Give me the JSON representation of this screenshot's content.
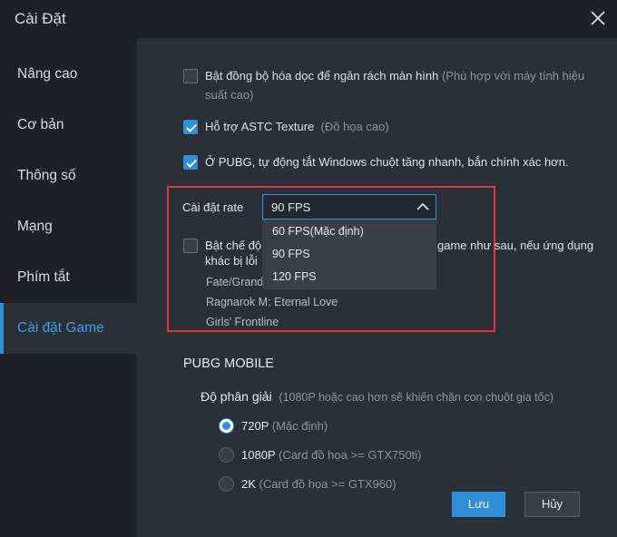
{
  "window": {
    "title": "Cài Đặt"
  },
  "sidebar": {
    "items": [
      {
        "label": "Nâng cao"
      },
      {
        "label": "Cơ bản"
      },
      {
        "label": "Thông số"
      },
      {
        "label": "Mạng"
      },
      {
        "label": "Phím tắt"
      },
      {
        "label": "Cài đặt Game",
        "active": true
      }
    ]
  },
  "options": {
    "vsync": {
      "label": "Bật đồng bộ hóa dọc để ngăn rách màn hình",
      "hint": "(Phù hợp với máy tính hiệu suất cao)",
      "checked": false
    },
    "astc": {
      "label": "Hỗ trợ ASTC Texture",
      "hint": "(Đồ họa cao)",
      "checked": true
    },
    "pubg_mouse": {
      "label": "Ở PUBG, tự động tắt Windows chuột tăng nhanh, bắn chính xác hơn.",
      "checked": true
    }
  },
  "rate": {
    "label": "Cài đặt rate",
    "selected": "90 FPS",
    "options": [
      "60  FPS(Mặc định)",
      "90 FPS",
      "120 FPS"
    ]
  },
  "highfps": {
    "label_start": "Bật chế độ",
    "label_end": "game như sau, nếu ứng dụng",
    "label_line2": "khác bị lỗi",
    "checked": false,
    "games": [
      "Fate/Grand",
      "Ragnarok M: Eternal Love",
      "Girls' Frontline"
    ]
  },
  "pubg": {
    "section_title": "PUBG MOBILE",
    "resolution_label": "Độ phân giải",
    "resolution_hint": "(1080P hoặc cao hơn sẽ khiến chặn con chuột gia tốc)",
    "resolutions": [
      {
        "name": "720P",
        "hint": "(Mặc định)",
        "selected": true
      },
      {
        "name": "1080P",
        "hint": "(Card đồ họa >= GTX750ti)",
        "selected": false
      },
      {
        "name": "2K",
        "hint": "(Card đồ họa >= GTX960)",
        "selected": false
      }
    ]
  },
  "buttons": {
    "save": "Lưu",
    "cancel": "Hủy"
  },
  "colors": {
    "accent": "#2f8fd8",
    "highlight_box": "#e0353b",
    "background": "#2b3038",
    "sidebar": "#1d2026"
  },
  "icons": {
    "close": "close-icon",
    "check": "check-icon",
    "chevron": "chevron-up-icon"
  }
}
